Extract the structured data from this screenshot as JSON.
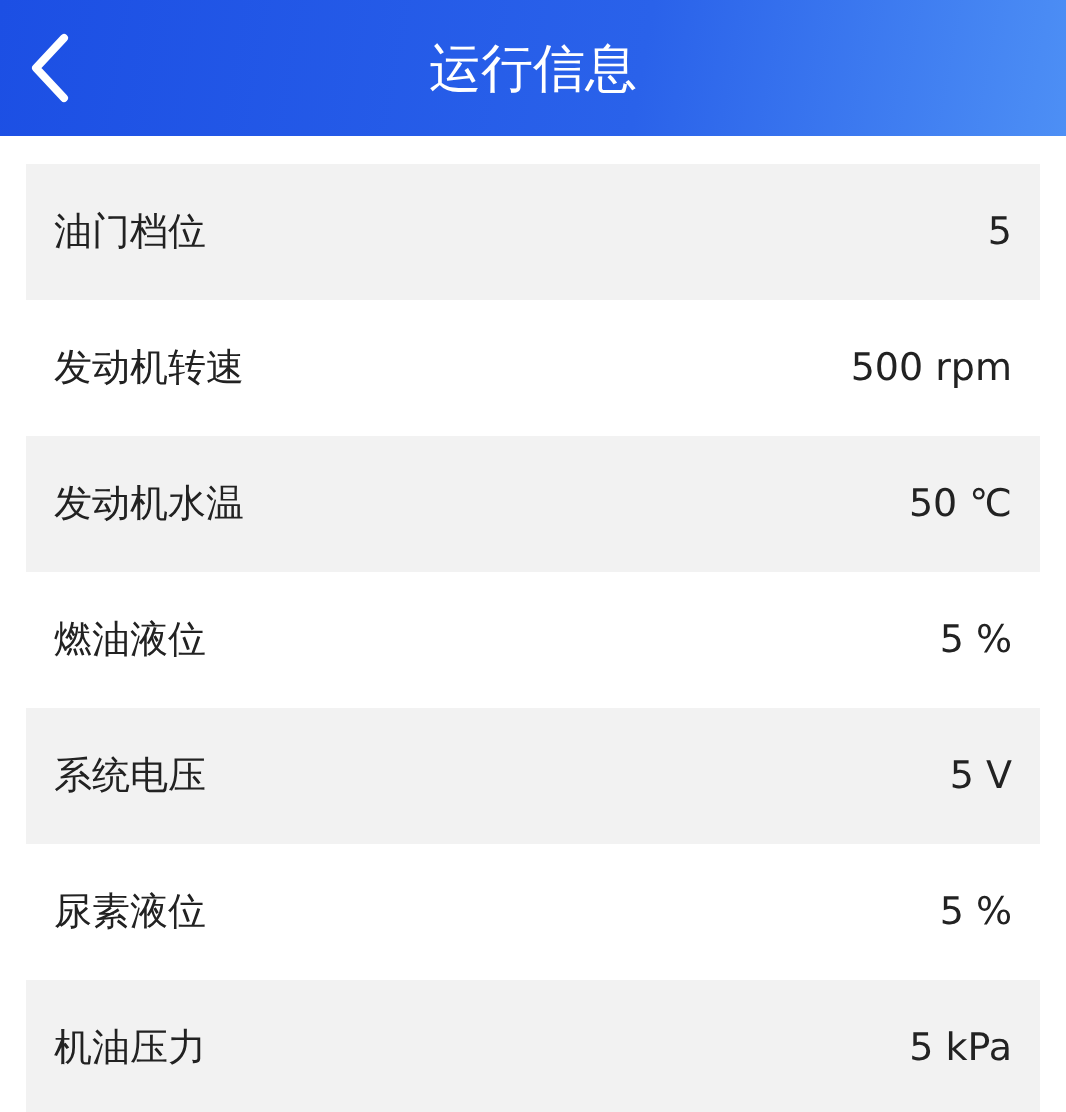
{
  "header": {
    "title": "运行信息"
  },
  "rows": [
    {
      "label": "油门档位",
      "value": "5"
    },
    {
      "label": "发动机转速",
      "value": "500 rpm"
    },
    {
      "label": "发动机水温",
      "value": "50 ℃"
    },
    {
      "label": "燃油液位",
      "value": "5 %"
    },
    {
      "label": "系统电压",
      "value": "5 V"
    },
    {
      "label": "尿素液位",
      "value": "5 %"
    },
    {
      "label": "机油压力",
      "value": "5 kPa"
    }
  ]
}
